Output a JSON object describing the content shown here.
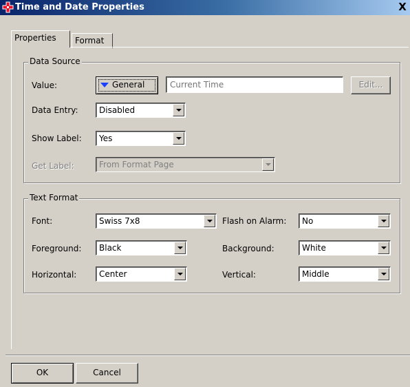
{
  "window": {
    "title": "Time and Date Properties",
    "close_glyph": "X"
  },
  "tabs": [
    {
      "label": "Properties",
      "active": true
    },
    {
      "label": "Format",
      "active": false
    }
  ],
  "data_source": {
    "legend": "Data Source",
    "value_label": "Value:",
    "general_button": "General",
    "value_placeholder": "Current Time",
    "edit_button": "Edit...",
    "data_entry_label": "Data Entry:",
    "data_entry_value": "Disabled",
    "show_label_label": "Show Label:",
    "show_label_value": "Yes",
    "get_label_label": "Get Label:",
    "get_label_value": "From Format Page"
  },
  "text_format": {
    "legend": "Text Format",
    "font_label": "Font:",
    "font_value": "Swiss 7x8",
    "flash_label": "Flash on Alarm:",
    "flash_value": "No",
    "foreground_label": "Foreground:",
    "foreground_value": "Black",
    "background_label": "Background:",
    "background_value": "White",
    "horizontal_label": "Horizontal:",
    "horizontal_value": "Center",
    "vertical_label": "Vertical:",
    "vertical_value": "Middle"
  },
  "footer": {
    "ok_label": "OK",
    "cancel_label": "Cancel"
  },
  "colors": {
    "titlebar_start": "#0a246a",
    "titlebar_end": "#a6caf0",
    "dialog_face": "#d4d0c8",
    "accent_arrow": "#1a40ff"
  }
}
